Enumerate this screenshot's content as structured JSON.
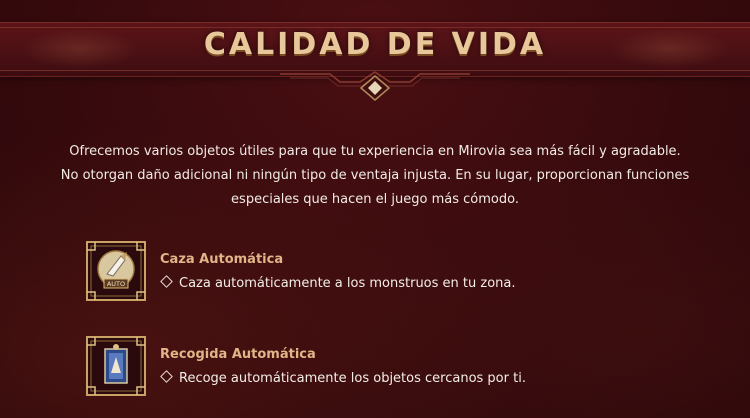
{
  "header": {
    "title": "CALIDAD DE VIDA"
  },
  "intro": {
    "line1": "Ofrecemos varios objetos útiles para que tu experiencia en Mirovia sea más fácil y agradable.",
    "line2": "No otorgan daño adicional ni ningún tipo de ventaja injusta. En su lugar, proporcionan funciones",
    "line3": "especiales que hacen el juego más cómodo."
  },
  "items": [
    {
      "title": "Caza Automática",
      "description": "Caza automáticamente a los monstruos en tu zona.",
      "icon": "auto-hunt-icon",
      "icon_label": "AUTO"
    },
    {
      "title": "Recogida Automática",
      "description": "Recoge automáticamente los objetos cercanos por ti.",
      "icon": "auto-loot-icon"
    }
  ],
  "colors": {
    "background": "#3a0b0e",
    "title": "#e8c89a",
    "item_title": "#e2b487",
    "text": "#f2ebe6",
    "frame_gold": "#c9a266"
  }
}
